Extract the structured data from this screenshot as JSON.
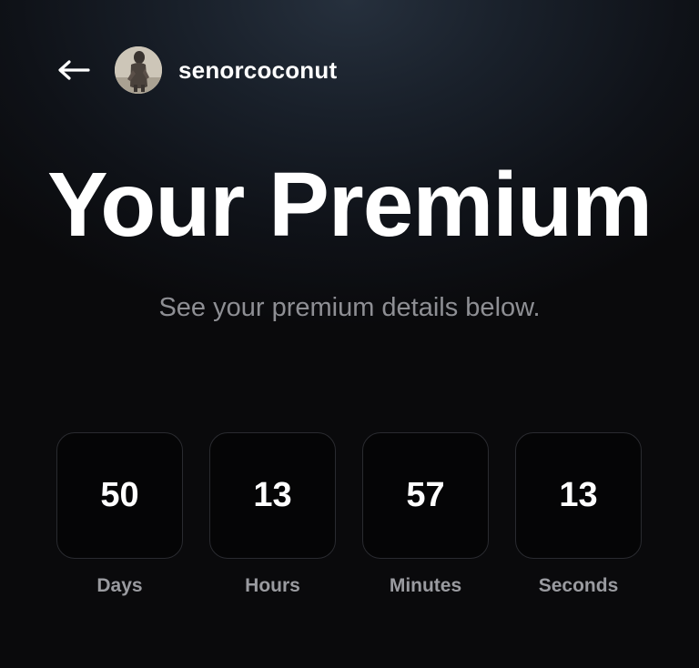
{
  "header": {
    "back_icon": "arrow-left-icon",
    "username": "senorcoconut"
  },
  "title": "Your Premium",
  "subtitle": "See your premium details below.",
  "countdown": [
    {
      "value": "50",
      "label": "Days"
    },
    {
      "value": "13",
      "label": "Hours"
    },
    {
      "value": "57",
      "label": "Minutes"
    },
    {
      "value": "13",
      "label": "Seconds"
    }
  ],
  "colors": {
    "background": "#0a0a0c",
    "text": "#ffffff",
    "subtitle": "#8e8f94",
    "box_border": "#2a2b30"
  }
}
